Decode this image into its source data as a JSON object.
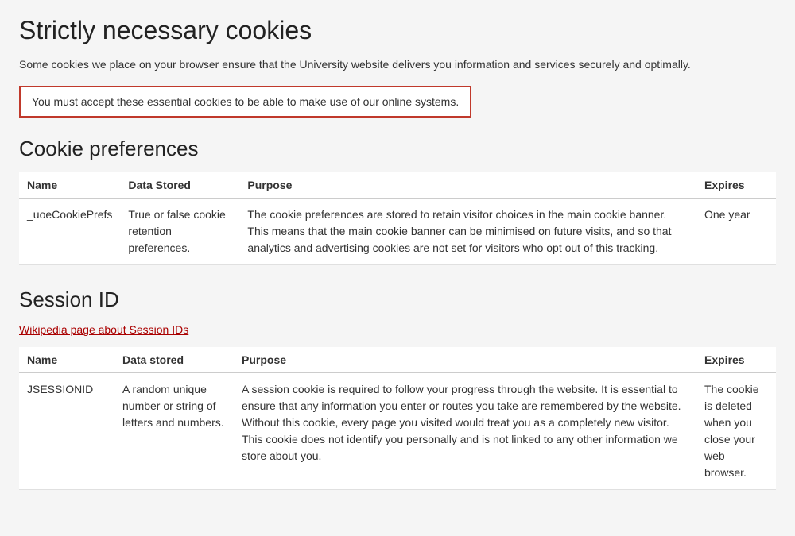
{
  "page": {
    "main_title": "Strictly necessary cookies",
    "intro_text": "Some cookies we place on your browser ensure that the University website delivers you information and services securely and optimally.",
    "warning_message": "You must accept these essential cookies to be able to make use of our online systems.",
    "cookie_preferences": {
      "section_title": "Cookie preferences",
      "table": {
        "headers": [
          "Name",
          "Data Stored",
          "Purpose",
          "Expires"
        ],
        "rows": [
          {
            "name": "_uoeCookiePrefs",
            "data_stored": "True or false cookie retention preferences.",
            "purpose": "The cookie preferences are stored to retain visitor choices in the main cookie banner. This means that the main cookie banner can be minimised on future visits, and so that analytics and advertising cookies are not set for visitors who opt out of this tracking.",
            "expires": "One year"
          }
        ]
      }
    },
    "session_id": {
      "section_title": "Session ID",
      "wiki_link_text": "Wikipedia page about Session IDs",
      "table": {
        "headers": [
          "Name",
          "Data stored",
          "Purpose",
          "Expires"
        ],
        "rows": [
          {
            "name": "JSESSIONID",
            "data_stored": "A random unique number or string of letters and numbers.",
            "purpose": "A session cookie is required to follow your progress through the website. It is essential to ensure that any information you enter or routes you take are remembered by the website. Without this cookie, every page you visited would treat you as a completely new visitor. This cookie does not identify you personally and is not linked to any other information we store about you.",
            "expires": "The cookie is deleted when you close your web browser."
          }
        ]
      }
    }
  }
}
